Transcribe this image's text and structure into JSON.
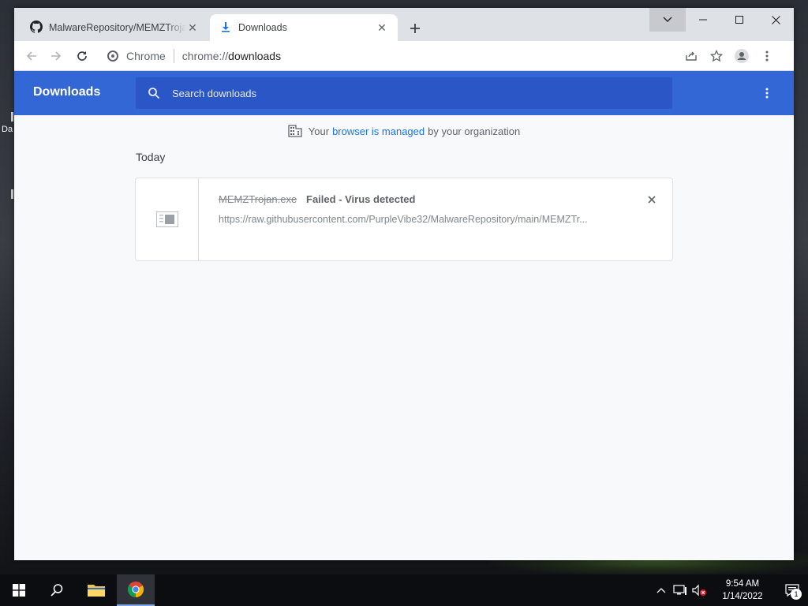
{
  "desktop": {
    "label": "Da"
  },
  "browser": {
    "tabs": [
      {
        "title": "MalwareRepository/MEMZTrojan",
        "icon": "github-icon",
        "active": false
      },
      {
        "title": "Downloads",
        "icon": "download-icon",
        "active": true
      }
    ],
    "omnibox": {
      "site_label": "Chrome",
      "url_scheme": "chrome://",
      "url_host": "downloads"
    }
  },
  "downloads_page": {
    "title": "Downloads",
    "search_placeholder": "Search downloads",
    "managed_notice": {
      "prefix": "Your",
      "link": "browser is managed",
      "suffix": "by your organization"
    },
    "sections": [
      {
        "date": "Today",
        "items": [
          {
            "file_name": "MEMZTrojan.exe",
            "status": "Failed - Virus detected",
            "url": "https://raw.githubusercontent.com/PurpleVibe32/MalwareRepository/main/MEMZTr..."
          }
        ]
      }
    ]
  },
  "taskbar": {
    "apps": [
      "start",
      "search",
      "file-explorer",
      "chrome"
    ],
    "clock": {
      "time": "9:54 AM",
      "date": "1/14/2022"
    },
    "notification_count": "1"
  },
  "colors": {
    "header_blue": "#3367d6",
    "search_blue": "#2a56c6",
    "link_blue": "#1a73e8"
  }
}
